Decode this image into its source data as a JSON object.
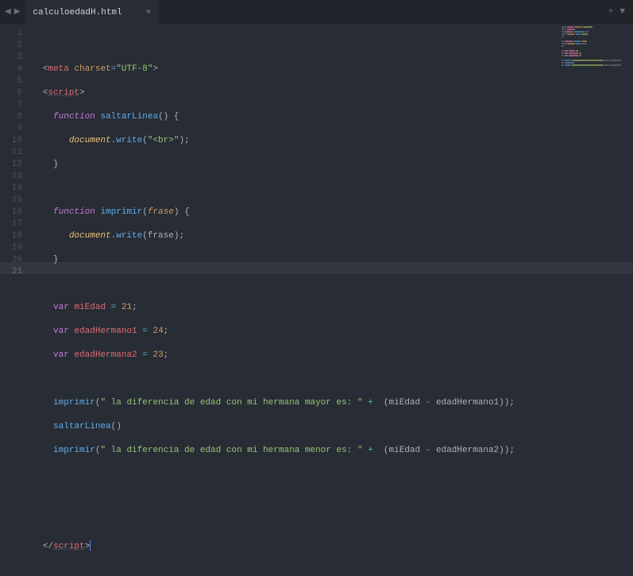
{
  "tabbar": {
    "nav_prev": "◀",
    "nav_next": "▶",
    "tab_label": "calculoedadH.html",
    "tab_close": "×",
    "add": "+",
    "menu": "▼"
  },
  "gutter": {
    "lines": [
      "1",
      "2",
      "3",
      "4",
      "5",
      "6",
      "7",
      "8",
      "9",
      "10",
      "11",
      "12",
      "13",
      "14",
      "15",
      "16",
      "17",
      "18",
      "19",
      "20",
      "21"
    ],
    "active_index": 20
  },
  "code": {
    "l1": {
      "lt": "<",
      "tag": "meta",
      "sp": " ",
      "attr": "charset",
      "eq": "=",
      "str": "\"UTF-8\"",
      "gt": ">"
    },
    "l2": {
      "lt": "<",
      "tag": "script",
      "gt": ">"
    },
    "l3": {
      "kw": "function",
      "name": "saltarLinea",
      "op": "() {"
    },
    "l4": {
      "obj": "document",
      "dot": ".",
      "method": "write",
      "op1": "(",
      "str": "\"<br>\"",
      "op2": ");"
    },
    "l5": {
      "brace": "}"
    },
    "l7": {
      "kw": "function",
      "name": "imprimir",
      "op1": "(",
      "param": "frase",
      "op2": ") {"
    },
    "l8": {
      "obj": "document",
      "dot": ".",
      "method": "write",
      "op1": "(",
      "arg": "frase",
      "op2": ");"
    },
    "l9": {
      "brace": "}"
    },
    "l11": {
      "kw": "var",
      "ident": "miEdad",
      "eq": " = ",
      "num": "21",
      "semi": ";"
    },
    "l12": {
      "kw": "var",
      "ident": "edadHermano1",
      "eq": " = ",
      "num": "24",
      "semi": ";"
    },
    "l13": {
      "kw": "var",
      "ident": "edadHermana2",
      "eq": " = ",
      "num": "23",
      "semi": ";"
    },
    "l15": {
      "fn": "imprimir",
      "op1": "(",
      "str": "\" la diferencia de edad con mi hermana mayor es: \"",
      "plus": " +  ",
      "op2": "(",
      "a": "miEdad",
      "minus": " - ",
      "b": "edadHermano1",
      "op3": "));"
    },
    "l16": {
      "fn": "saltarLinea",
      "op": "()"
    },
    "l17": {
      "fn": "imprimir",
      "op1": "(",
      "str": "\" la diferencia de edad con mi hermana menor es: \"",
      "plus": " +  ",
      "op2": "(",
      "a": "miEdad",
      "minus": " - ",
      "b": "edadHermana2",
      "op3": "));"
    },
    "l21": {
      "lt": "</",
      "tag": "script",
      "gt": ">"
    }
  }
}
